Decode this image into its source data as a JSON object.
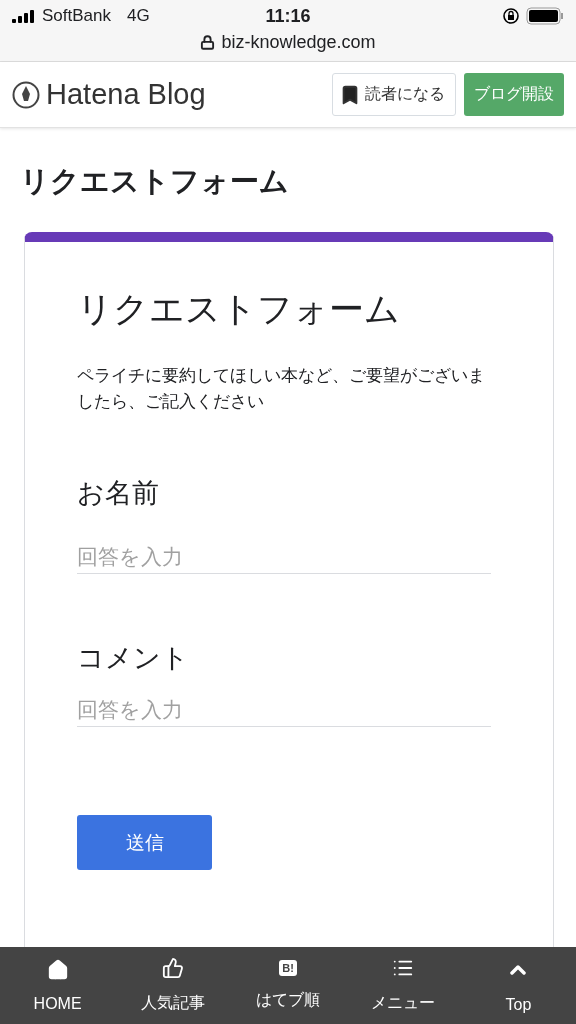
{
  "status_bar": {
    "carrier": "SoftBank",
    "network": "4G",
    "time": "11:16",
    "url": "biz-knowledge.com"
  },
  "header": {
    "logo": "Hatena Blog",
    "subscribe_button": "読者になる",
    "start_blog_button": "ブログ開設"
  },
  "page_title": "リクエストフォーム",
  "form": {
    "title": "リクエストフォーム",
    "description": "ペライチに要約してほしい本など、ご要望がございましたら、ご記入ください",
    "fields": [
      {
        "label": "お名前",
        "placeholder": "回答を入力"
      },
      {
        "label": "コメント",
        "placeholder": "回答を入力"
      }
    ],
    "submit": "送信"
  },
  "bottom_nav": [
    {
      "kind": "home",
      "label": "HOME"
    },
    {
      "kind": "like",
      "label": "人気記事"
    },
    {
      "kind": "hatebu",
      "badge": "B!",
      "label": "はてブ順"
    },
    {
      "kind": "menu",
      "label": "メニュー"
    },
    {
      "kind": "top",
      "label": "Top"
    }
  ]
}
